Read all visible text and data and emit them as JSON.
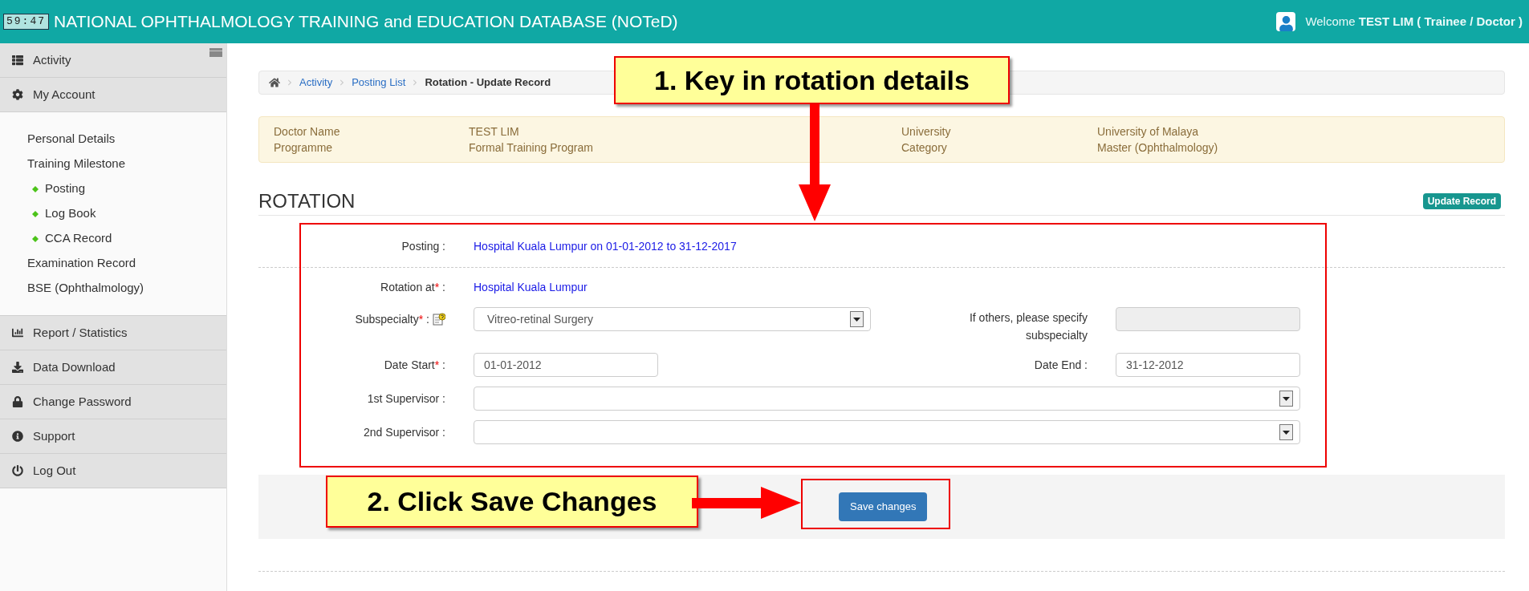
{
  "header": {
    "timer": "59:47",
    "title": "NATIONAL OPHTHALMOLOGY TRAINING and EDUCATION DATABASE (NOTeD)",
    "welcome": "Welcome **TEST LIM ( Trainee / Doctor )**"
  },
  "sidebar": {
    "items": [
      {
        "label": "Activity"
      },
      {
        "label": "My Account",
        "expanded": true,
        "children": [
          {
            "label": "Personal Details"
          },
          {
            "label": "Training Milestone",
            "children": [
              {
                "label": "Posting"
              },
              {
                "label": "Log Book"
              },
              {
                "label": "CCA Record"
              }
            ]
          },
          {
            "label": "Examination Record"
          },
          {
            "label": "BSE (Ophthalmology)"
          }
        ]
      },
      {
        "label": "Report / Statistics"
      },
      {
        "label": "Data Download"
      },
      {
        "label": "Change Password"
      },
      {
        "label": "Support"
      },
      {
        "label": "Log Out"
      }
    ]
  },
  "breadcrumb": [
    {
      "label": "Activity",
      "current": false
    },
    {
      "label": "Posting List",
      "current": false
    },
    {
      "label": "Rotation - Update Record",
      "current": true
    }
  ],
  "info": [
    {
      "label": "Doctor Name",
      "value": "TEST LIM"
    },
    {
      "label": "University",
      "value": "University of Malaya"
    },
    {
      "label": "Programme",
      "value": "Formal Training Program"
    },
    {
      "label": "Category",
      "value": "Master (Ophthalmology)"
    }
  ],
  "section": {
    "title": "ROTATION",
    "badge": "Update Record"
  },
  "form": {
    "posting": {
      "label": "Posting",
      "colon": ":",
      "value": "Hospital Kuala Lumpur on 01-01-2012 to 31-12-2017"
    },
    "rotation_at": {
      "label": "Rotation at",
      "required_mark": "*",
      "colon": ":",
      "value": "Hospital Kuala Lumpur"
    },
    "subspecialty": {
      "label": "Subspecialty",
      "required_mark": "*",
      "colon": ":",
      "help": true,
      "value": "Vitreo-retinal Surgery"
    },
    "others": {
      "label": "If others, please specify subspecialty",
      "disabled": true
    },
    "date_start": {
      "label": "Date Start",
      "required_mark": "*",
      "colon": ":",
      "value": "01-01-2012"
    },
    "date_end": {
      "label": "Date End",
      "colon": ":",
      "value": "31-12-2012"
    },
    "supervisor_1": {
      "label": "1st Supervisor",
      "colon": ":"
    },
    "supervisor_2": {
      "label": "2nd Supervisor",
      "colon": ":"
    }
  },
  "save_button": "Save changes",
  "annotations": [
    {
      "text": "1. Key in rotation details"
    },
    {
      "text": "2. Click Save Changes"
    }
  ]
}
